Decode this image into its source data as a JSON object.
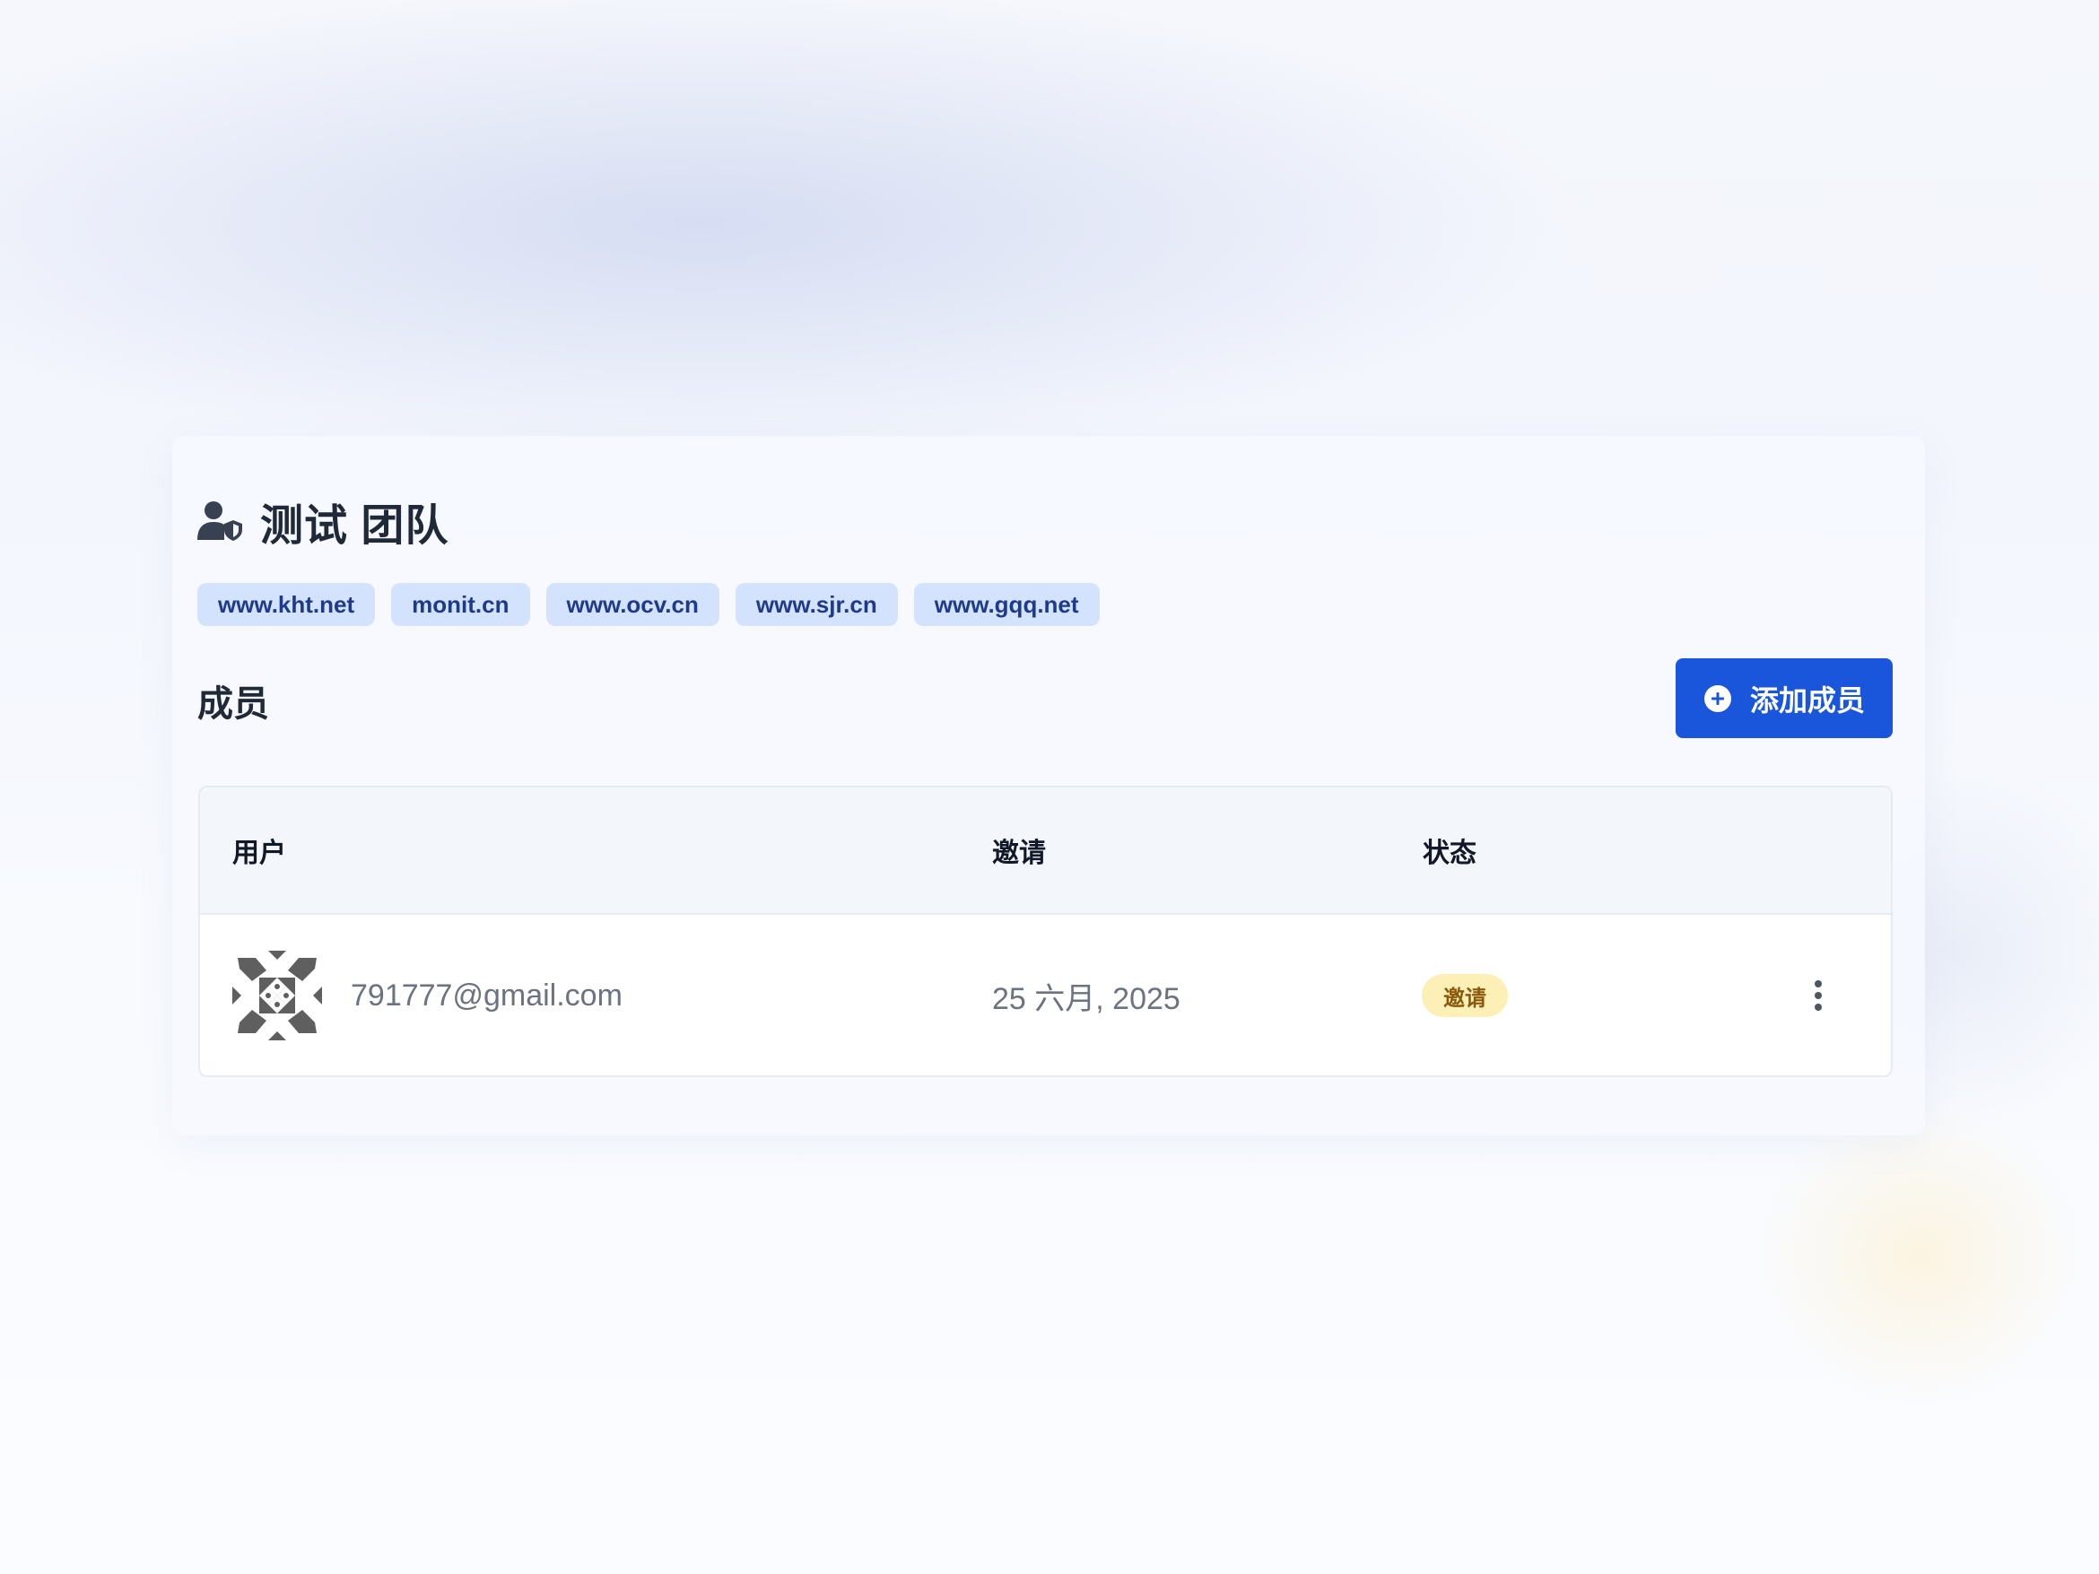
{
  "team": {
    "name": "测试 团队",
    "icon": "user-shield-icon",
    "domains": [
      "www.kht.net",
      "monit.cn",
      "www.ocv.cn",
      "www.sjr.cn",
      "www.gqq.net"
    ]
  },
  "members": {
    "section_title": "成员",
    "add_button": {
      "label": "添加成员",
      "icon": "plus-circle-icon"
    },
    "table": {
      "columns": [
        "用户",
        "邀请",
        "状态"
      ],
      "rows": [
        {
          "email": "791777@gmail.com",
          "invited": "25 六月, 2025",
          "status": "邀请",
          "avatar": "identicon-avatar"
        }
      ]
    }
  },
  "colors": {
    "primary": "#1a56db",
    "chip_bg": "#d4e3fd",
    "chip_text": "#1e3a8a",
    "badge_bg": "#fdf0b6",
    "badge_text": "#8a5a0b"
  }
}
